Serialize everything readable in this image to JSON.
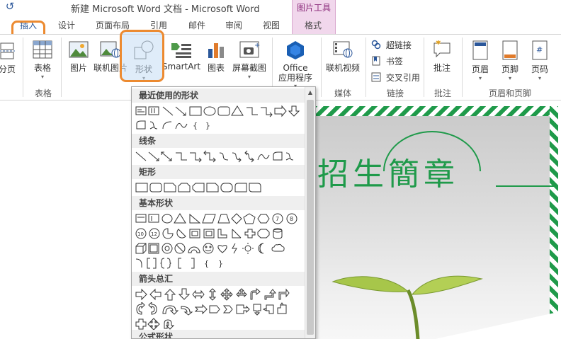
{
  "title_bar": {
    "document_title": "新建 Microsoft Word 文档 - Microsoft Word",
    "context_group": "图片工具",
    "undo_icon": "undo-icon"
  },
  "tabs": [
    {
      "label": "插入",
      "active": true
    },
    {
      "label": "设计"
    },
    {
      "label": "页面布局"
    },
    {
      "label": "引用"
    },
    {
      "label": "邮件"
    },
    {
      "label": "审阅"
    },
    {
      "label": "视图"
    },
    {
      "label": "格式"
    }
  ],
  "ribbon": {
    "page_break_label": "分页",
    "table_label": "表格",
    "table_group": "表格",
    "picture_label": "图片",
    "online_picture_label": "联机图片",
    "shapes_label": "形状",
    "smartart_label": "SmartArt",
    "chart_label": "图表",
    "screenshot_label": "屏幕截图",
    "office_label_1": "Office",
    "office_label_2": "应用程序",
    "online_video_label": "联机视频",
    "media_group": "媒体",
    "hyperlink_label": "超链接",
    "bookmark_label": "书签",
    "cross_ref_label": "交叉引用",
    "links_group": "链接",
    "comment_label": "批注",
    "comment_group": "批注",
    "header_label": "页眉",
    "footer_label": "页脚",
    "page_number_label": "页码",
    "header_footer_group": "页眉和页脚"
  },
  "shapes_menu": {
    "sections": [
      {
        "title": "最近使用的形状"
      },
      {
        "title": "线条"
      },
      {
        "title": "矩形"
      },
      {
        "title": "基本形状"
      },
      {
        "title": "箭头总汇"
      },
      {
        "title": "公式形状"
      }
    ],
    "brace_glyphs": [
      "{",
      "}"
    ]
  },
  "document": {
    "poster_title": "招生簡章"
  },
  "colors": {
    "accent_blue": "#2b579a",
    "highlight_orange": "#ec8a30",
    "context_pink": "#f1d7ec",
    "poster_green": "#1f9a4a"
  }
}
